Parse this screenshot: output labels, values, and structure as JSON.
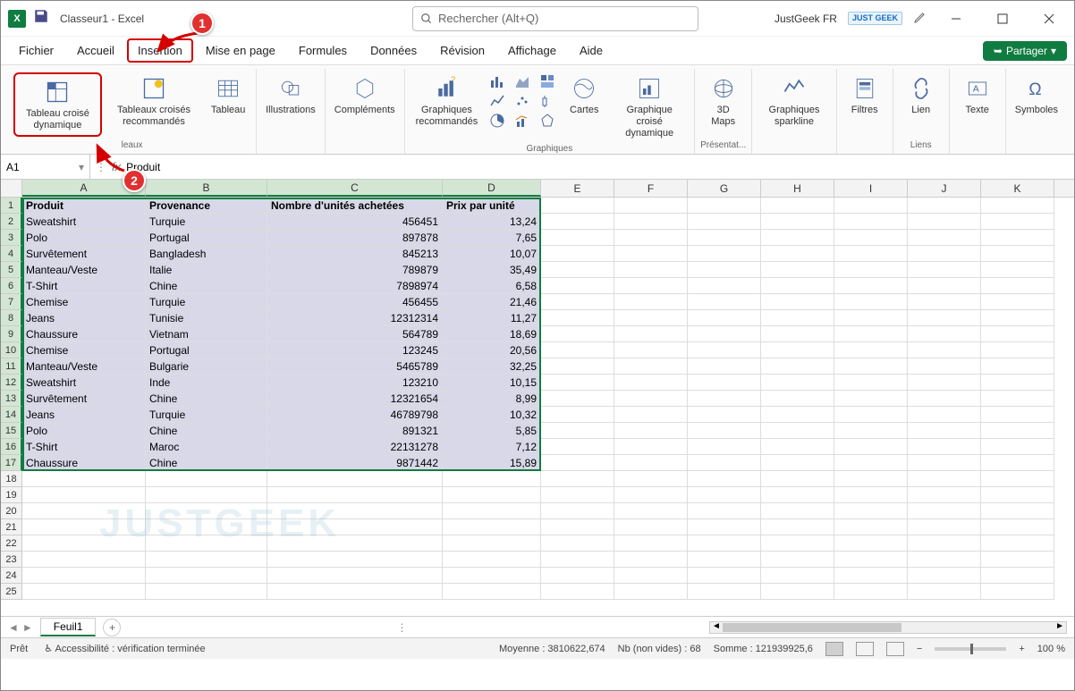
{
  "titlebar": {
    "app_title": "Classeur1 - Excel",
    "search_placeholder": "Rechercher (Alt+Q)",
    "user_name": "JustGeek FR",
    "user_badge": "JUST GEEK"
  },
  "tabs": {
    "items": [
      "Fichier",
      "Accueil",
      "Insertion",
      "Mise en page",
      "Formules",
      "Données",
      "Révision",
      "Affichage",
      "Aide"
    ],
    "active_index": 2,
    "share_label": "Partager"
  },
  "annotations": {
    "a1": "1",
    "a2": "2"
  },
  "ribbon": {
    "pivot": "Tableau croisé dynamique",
    "pivot_rec": "Tableaux croisés recommandés",
    "table": "Tableau",
    "illus": "Illustrations",
    "addins": "Compléments",
    "chart_rec": "Graphiques recommandés",
    "maps": "Cartes",
    "pivotchart": "Graphique croisé dynamique",
    "maps3d": "3D Maps",
    "sparklines": "Graphiques sparkline",
    "filters": "Filtres",
    "link": "Lien",
    "text": "Texte",
    "symbols": "Symboles",
    "grp_tables": "leaux",
    "grp_charts": "Graphiques",
    "grp_present": "Présentat...",
    "grp_links": "Liens"
  },
  "formula_bar": {
    "cell_ref": "A1",
    "formula": "Produit"
  },
  "columns": [
    "A",
    "B",
    "C",
    "D",
    "E",
    "F",
    "G",
    "H",
    "I",
    "J",
    "K"
  ],
  "headers": [
    "Produit",
    "Provenance",
    "Nombre d'unités achetées",
    "Prix par unité"
  ],
  "rows": [
    {
      "n": 1,
      "c": [
        "Produit",
        "Provenance",
        "Nombre d'unités achetées",
        "Prix par unité"
      ],
      "hdr": true
    },
    {
      "n": 2,
      "c": [
        "Sweatshirt",
        "Turquie",
        "456451",
        "13,24"
      ]
    },
    {
      "n": 3,
      "c": [
        "Polo",
        "Portugal",
        "897878",
        "7,65"
      ]
    },
    {
      "n": 4,
      "c": [
        "Survêtement",
        "Bangladesh",
        "845213",
        "10,07"
      ]
    },
    {
      "n": 5,
      "c": [
        "Manteau/Veste",
        "Italie",
        "789879",
        "35,49"
      ]
    },
    {
      "n": 6,
      "c": [
        "T-Shirt",
        "Chine",
        "7898974",
        "6,58"
      ]
    },
    {
      "n": 7,
      "c": [
        "Chemise",
        "Turquie",
        "456455",
        "21,46"
      ]
    },
    {
      "n": 8,
      "c": [
        "Jeans",
        "Tunisie",
        "12312314",
        "11,27"
      ]
    },
    {
      "n": 9,
      "c": [
        "Chaussure",
        "Vietnam",
        "564789",
        "18,69"
      ]
    },
    {
      "n": 10,
      "c": [
        "Chemise",
        "Portugal",
        "123245",
        "20,56"
      ]
    },
    {
      "n": 11,
      "c": [
        "Manteau/Veste",
        "Bulgarie",
        "5465789",
        "32,25"
      ]
    },
    {
      "n": 12,
      "c": [
        "Sweatshirt",
        "Inde",
        "123210",
        "10,15"
      ]
    },
    {
      "n": 13,
      "c": [
        "Survêtement",
        "Chine",
        "12321654",
        "8,99"
      ]
    },
    {
      "n": 14,
      "c": [
        "Jeans",
        "Turquie",
        "46789798",
        "10,32"
      ]
    },
    {
      "n": 15,
      "c": [
        "Polo",
        "Chine",
        "891321",
        "5,85"
      ]
    },
    {
      "n": 16,
      "c": [
        "T-Shirt",
        "Maroc",
        "22131278",
        "7,12"
      ]
    },
    {
      "n": 17,
      "c": [
        "Chaussure",
        "Chine",
        "9871442",
        "15,89"
      ]
    }
  ],
  "empty_rows": [
    18,
    19,
    20,
    21,
    22,
    23,
    24,
    25
  ],
  "sheet": {
    "name": "Feuil1"
  },
  "status": {
    "ready": "Prêt",
    "access": "Accessibilité : vérification terminée",
    "avg": "Moyenne : 3810622,674",
    "count": "Nb (non vides) : 68",
    "sum": "Somme : 121939925,6",
    "zoom": "100 %"
  },
  "watermark": "JUSTGEEK"
}
